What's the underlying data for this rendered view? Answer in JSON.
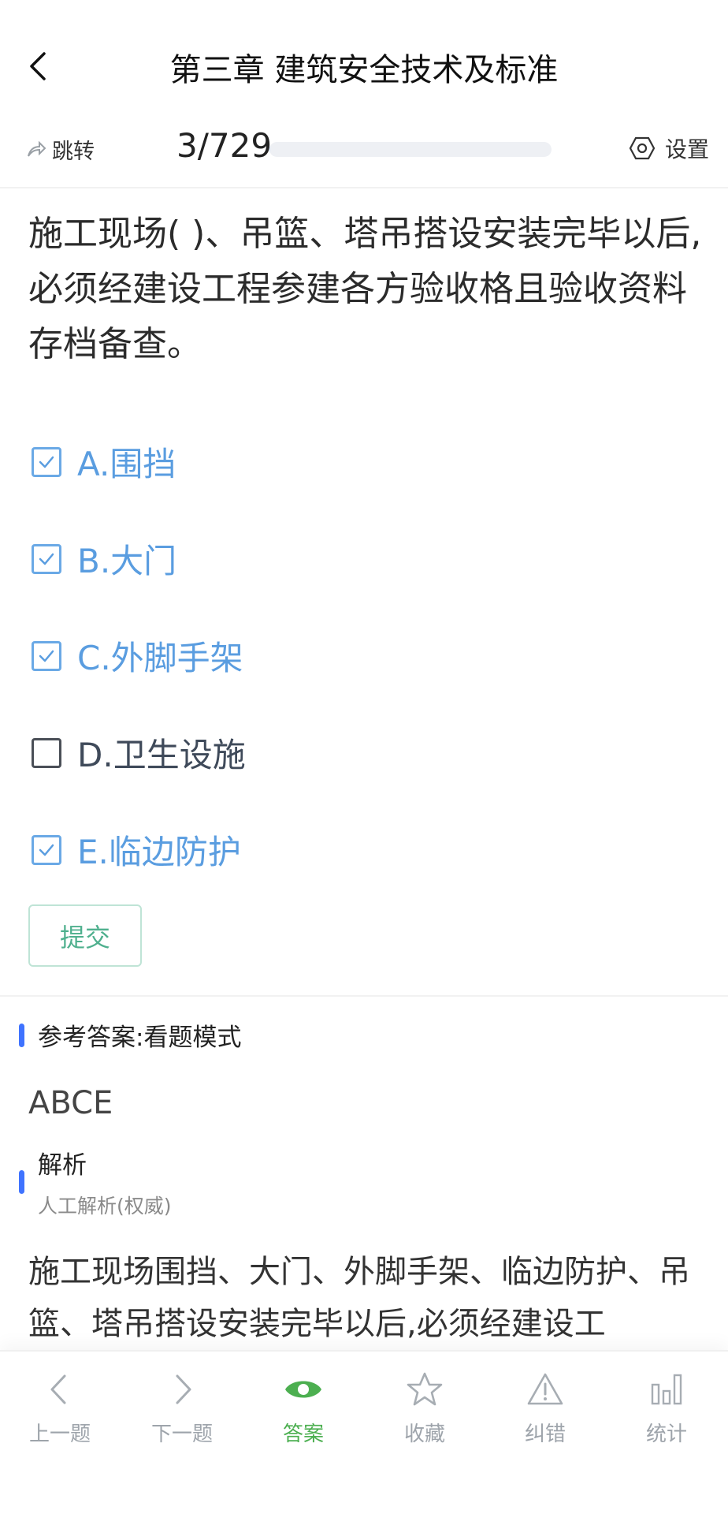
{
  "header": {
    "title": "第三章 建筑安全技术及标准"
  },
  "toolbar": {
    "jump_label": "跳转",
    "progress_text": "3/729",
    "progress_fraction": 0.004,
    "settings_label": "设置"
  },
  "question": {
    "text": "施工现场( )、吊篮、塔吊搭设安装完毕以后,必须经建设工程参建各方验收格且验收资料存档备查。",
    "options": [
      {
        "label": "A.围挡",
        "checked": true
      },
      {
        "label": "B.大门",
        "checked": true
      },
      {
        "label": "C.外脚手架",
        "checked": true
      },
      {
        "label": "D.卫生设施",
        "checked": false
      },
      {
        "label": "E.临边防护",
        "checked": true
      }
    ],
    "submit_label": "提交"
  },
  "answer": {
    "heading": "参考答案:看题模式",
    "value": "ABCE"
  },
  "analysis": {
    "heading": "解析",
    "subheading": "人工解析(权威)",
    "text": "施工现场围挡、大门、外脚手架、临边防护、吊篮、塔吊搭设安装完毕以后,必须经建设工"
  },
  "bottom_nav": {
    "items": [
      {
        "label": "上一题",
        "icon": "chevron-left-icon",
        "active": false
      },
      {
        "label": "下一题",
        "icon": "chevron-right-icon",
        "active": false
      },
      {
        "label": "答案",
        "icon": "eye-icon",
        "active": true
      },
      {
        "label": "收藏",
        "icon": "star-icon",
        "active": false
      },
      {
        "label": "纠错",
        "icon": "warning-icon",
        "active": false
      },
      {
        "label": "统计",
        "icon": "bar-chart-icon",
        "active": false
      }
    ]
  },
  "colors": {
    "checked": "#5a9de0",
    "accent": "#3f73ff",
    "active_tab": "#4caf50",
    "submit": "#4fb08e"
  }
}
